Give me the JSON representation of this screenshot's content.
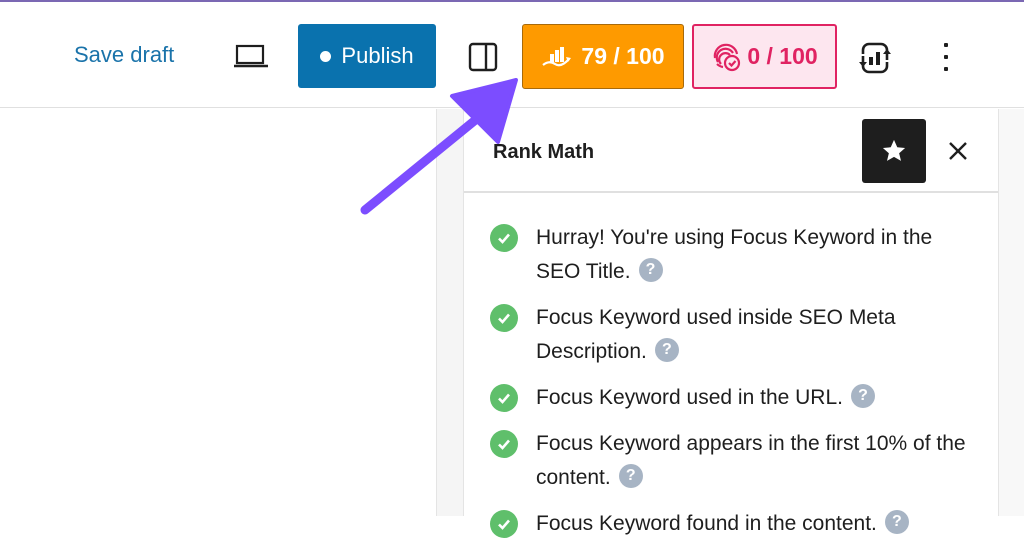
{
  "toolbar": {
    "save_draft_label": "Save draft",
    "preview_icon": "laptop-icon",
    "publish_label": "Publish",
    "sidebar_toggle_icon": "sidebar-icon",
    "seo_score": {
      "label": "79 / 100",
      "value": 79,
      "max": 100,
      "color": "#fe9a00",
      "icon": "seo-chart-icon"
    },
    "content_ai_score": {
      "label": "0 / 100",
      "value": 0,
      "max": 100,
      "color": "#e02362",
      "icon": "fingerprint-check-icon"
    },
    "analytics_icon": "analytics-refresh-icon",
    "more_icon": "more-vertical-icon"
  },
  "panel": {
    "title": "Rank Math",
    "star_icon": "star-icon",
    "close_icon": "close-icon",
    "checks": [
      {
        "text": "Hurray! You're using Focus Keyword in the SEO Title.",
        "status": "pass"
      },
      {
        "text": "Focus Keyword used inside SEO Meta Description.",
        "status": "pass"
      },
      {
        "text": "Focus Keyword used in the URL.",
        "status": "pass"
      },
      {
        "text": "Focus Keyword appears in the first 10% of the content.",
        "status": "pass"
      },
      {
        "text": "Focus Keyword found in the content.",
        "status": "pass"
      }
    ],
    "help_glyph": "?"
  },
  "annotation": {
    "arrow_color": "#7c4dff"
  }
}
